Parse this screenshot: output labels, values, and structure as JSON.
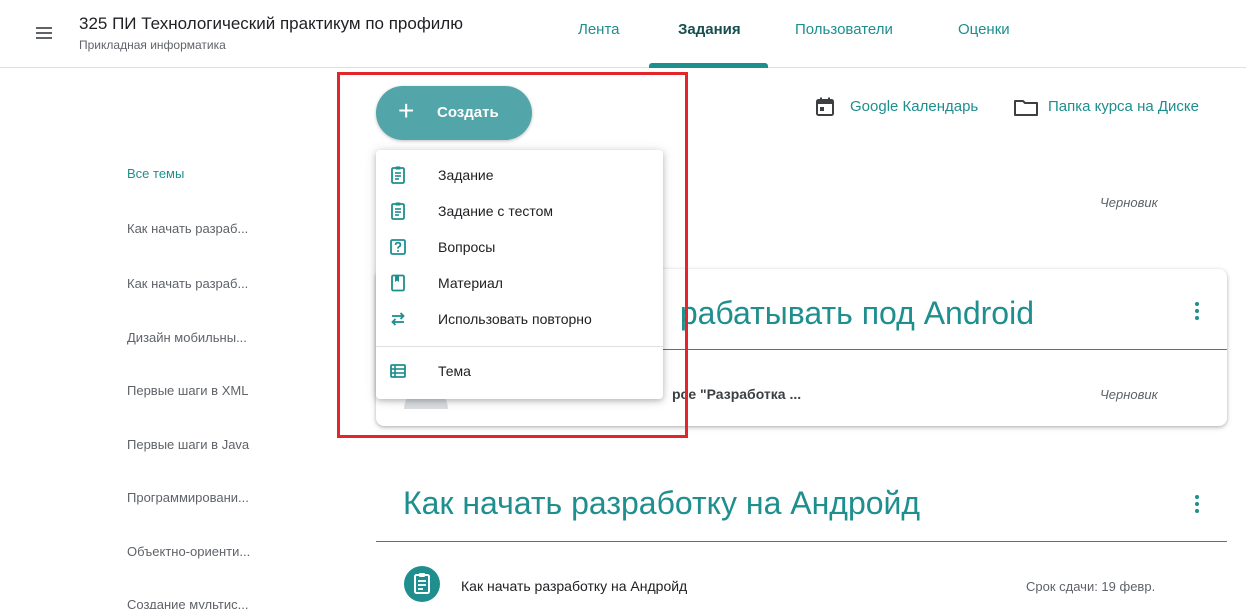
{
  "header": {
    "course_title": "325 ПИ Технологический практикум по профилю",
    "course_subtitle": "Прикладная информатика",
    "tabs": [
      {
        "label": "Лента"
      },
      {
        "label": "Задания"
      },
      {
        "label": "Пользователи"
      },
      {
        "label": "Оценки"
      }
    ],
    "active_tab": "Задания"
  },
  "sidebar": {
    "topics": [
      {
        "label": "Все темы"
      },
      {
        "label": "Как начать разраб..."
      },
      {
        "label": "Как начать разраб..."
      },
      {
        "label": "Дизайн мобильны..."
      },
      {
        "label": "Первые шаги в XML"
      },
      {
        "label": "Первые шаги в Java"
      },
      {
        "label": "Программировани..."
      },
      {
        "label": "Объектно-ориенти..."
      },
      {
        "label": "Создание мультис..."
      }
    ]
  },
  "toolbar": {
    "create_label": "Создать",
    "create_icon": "+",
    "calendar_label": "Google Календарь",
    "drive_label": "Папка курса на Диске"
  },
  "create_menu": {
    "items": [
      {
        "label": "Задание",
        "icon": "assignment-icon"
      },
      {
        "label": "Задание с тестом",
        "icon": "quiz-assignment-icon"
      },
      {
        "label": "Вопросы",
        "icon": "question-icon"
      },
      {
        "label": "Материал",
        "icon": "material-icon"
      },
      {
        "label": "Использовать повторно",
        "icon": "reuse-icon"
      },
      {
        "label": "Тема",
        "icon": "topic-icon"
      }
    ]
  },
  "content": {
    "draft_label_1": "Черновик",
    "card": {
      "title_visible": "рабатывать под Android",
      "item_visible": "рсе \"Разработка ...",
      "status": "Черновик"
    },
    "section": {
      "title": "Как начать разработку на Андройд",
      "assignment_title": "Как начать разработку на Андройд",
      "due": "Срок сдачи: 19 февр."
    }
  },
  "colors": {
    "accent": "#1e8e8e",
    "create_button": "#52a5a8",
    "highlight": "#e3262a"
  }
}
